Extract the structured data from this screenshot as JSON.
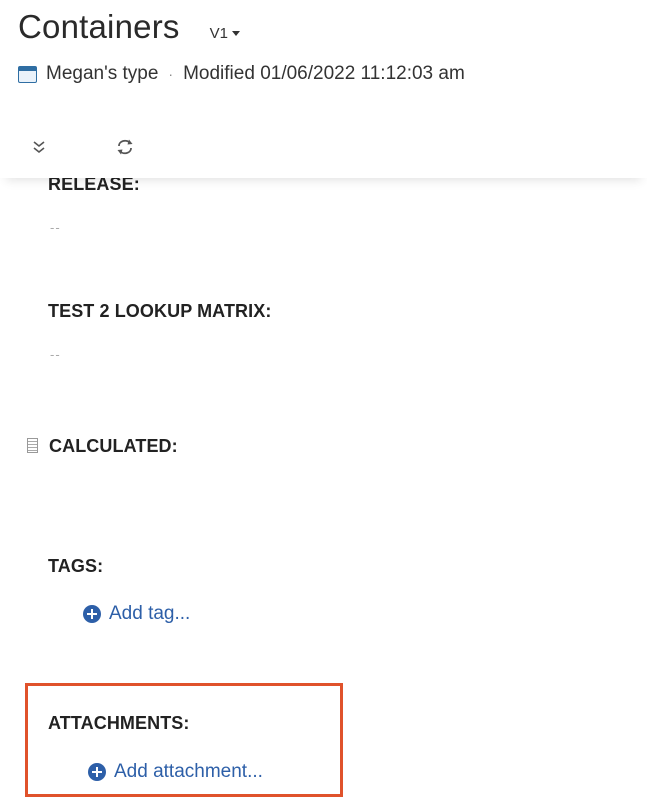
{
  "header": {
    "title": "Containers",
    "version": "V1",
    "type_name": "Megan's type",
    "separator": "·",
    "modified": "Modified 01/06/2022 11:12:03 am"
  },
  "toolbar": {
    "collapse_icon": "double-chevron-down-icon",
    "refresh_icon": "refresh-icon"
  },
  "fields": {
    "release": {
      "label": "RELEASE:",
      "value": "--"
    },
    "lookup": {
      "label": "TEST 2 LOOKUP MATRIX:",
      "value": "--"
    },
    "calculated": {
      "label": "CALCULATED:"
    },
    "tags": {
      "label": "TAGS:",
      "action": "Add tag..."
    },
    "attachments": {
      "label": "ATTACHMENTS:",
      "action": "Add attachment..."
    }
  },
  "colors": {
    "link": "#2d5fa8",
    "highlight": "#e0522b"
  }
}
